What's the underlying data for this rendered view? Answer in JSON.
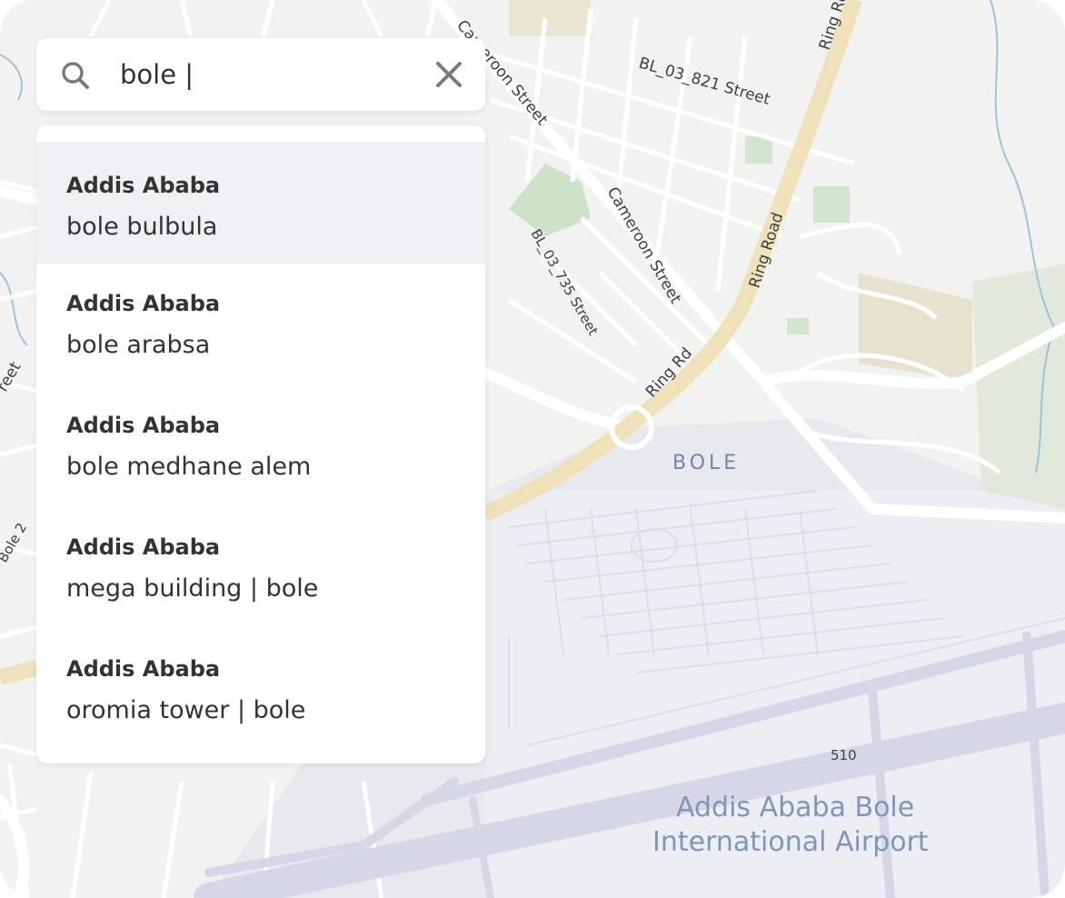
{
  "search": {
    "query": "bole |",
    "icon": "search-icon",
    "clear_icon": "close-icon"
  },
  "results": [
    {
      "city": "Addis Ababa",
      "place": "bole bulbula",
      "active": true
    },
    {
      "city": "Addis Ababa",
      "place": "bole arabsa",
      "active": false
    },
    {
      "city": "Addis Ababa",
      "place": "bole medhane alem",
      "active": false
    },
    {
      "city": "Addis Ababa",
      "place": "mega building | bole",
      "active": false
    },
    {
      "city": "Addis Ababa",
      "place": "oromia tower | bole",
      "active": false
    }
  ],
  "map_labels": {
    "street_1": "BL_03_821 Street",
    "street_2": "Cameroon Street",
    "street_3": "Cameroon Street",
    "street_4": "BL_03_735 Street",
    "street_5": "Ring Road",
    "street_6": "Ring Rd",
    "street_7": "Ring Rd",
    "street_8": "reet",
    "street_9": "Bole 2",
    "district": "BOLE",
    "airport_line1": "Addis Ababa Bole",
    "airport_line2": "International Airport",
    "road_number": "510"
  },
  "colors": {
    "land": "#eef0f3",
    "road": "#ffffff",
    "major_road": "#efe2bb",
    "park": "#cfe3cc",
    "airport_area": "#e6e7ee",
    "runway": "#d5d6e6",
    "water": "#9cc3d6",
    "label_blue": "#7f96b8"
  }
}
